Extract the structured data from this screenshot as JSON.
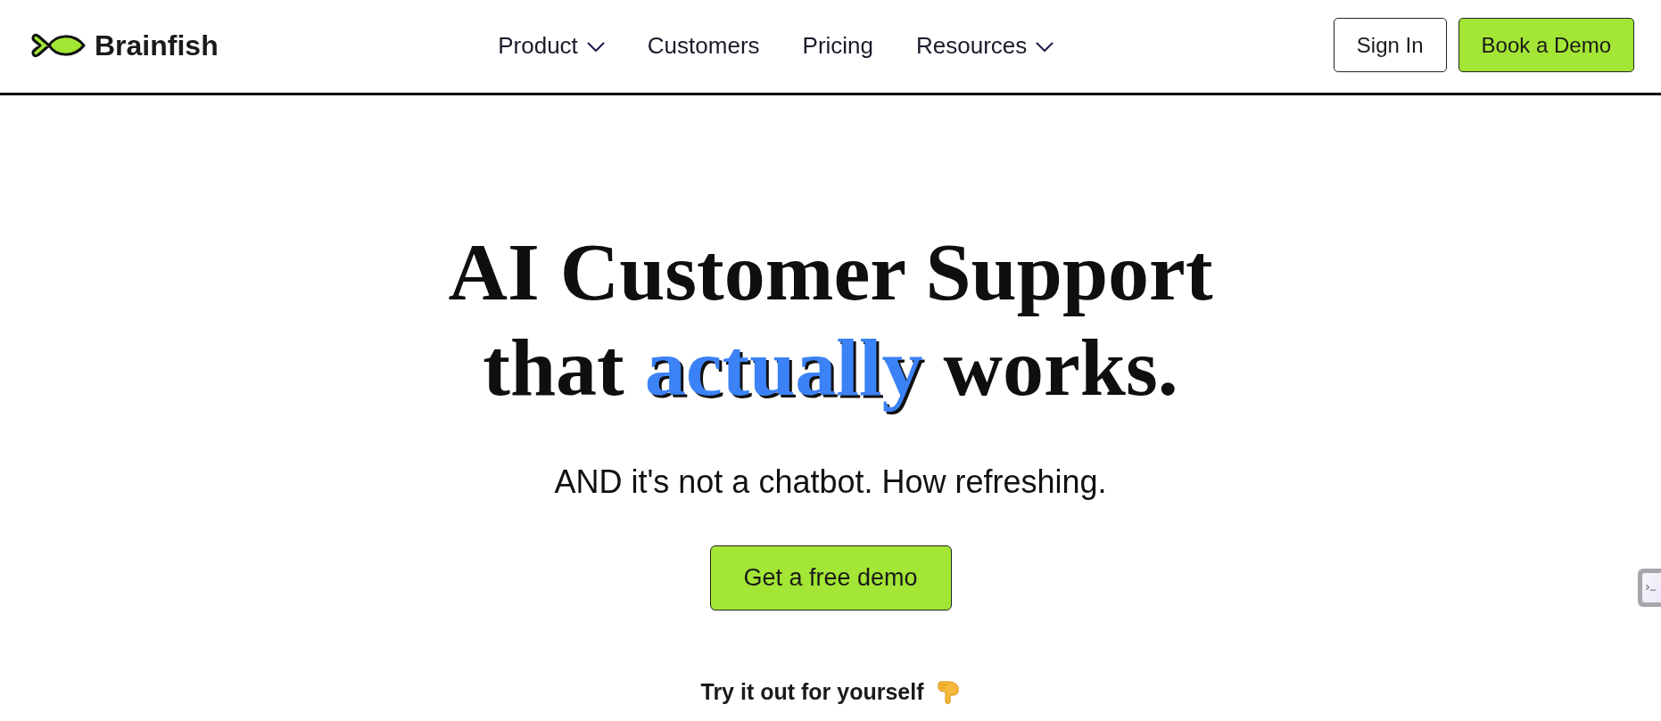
{
  "header": {
    "logo": {
      "name": "Brainfish"
    },
    "nav": [
      {
        "label": "Product",
        "has_menu": true
      },
      {
        "label": "Customers",
        "has_menu": false
      },
      {
        "label": "Pricing",
        "has_menu": false
      },
      {
        "label": "Resources",
        "has_menu": true
      }
    ],
    "actions": [
      {
        "label": "Sign In",
        "kind": "outline"
      },
      {
        "label": "Book a Demo",
        "kind": "primary"
      }
    ]
  },
  "hero": {
    "headline": [
      [
        {
          "text": "AI Customer Support",
          "highlight": false
        }
      ],
      [
        {
          "text": "that",
          "highlight": false
        },
        {
          "text": "actually",
          "highlight": true
        },
        {
          "text": "works.",
          "highlight": false
        }
      ]
    ],
    "subtitle": "AND it's not a chatbot. How refreshing.",
    "cta": {
      "label": "Get a free demo"
    },
    "prompt": "Try it out for yourself"
  }
}
